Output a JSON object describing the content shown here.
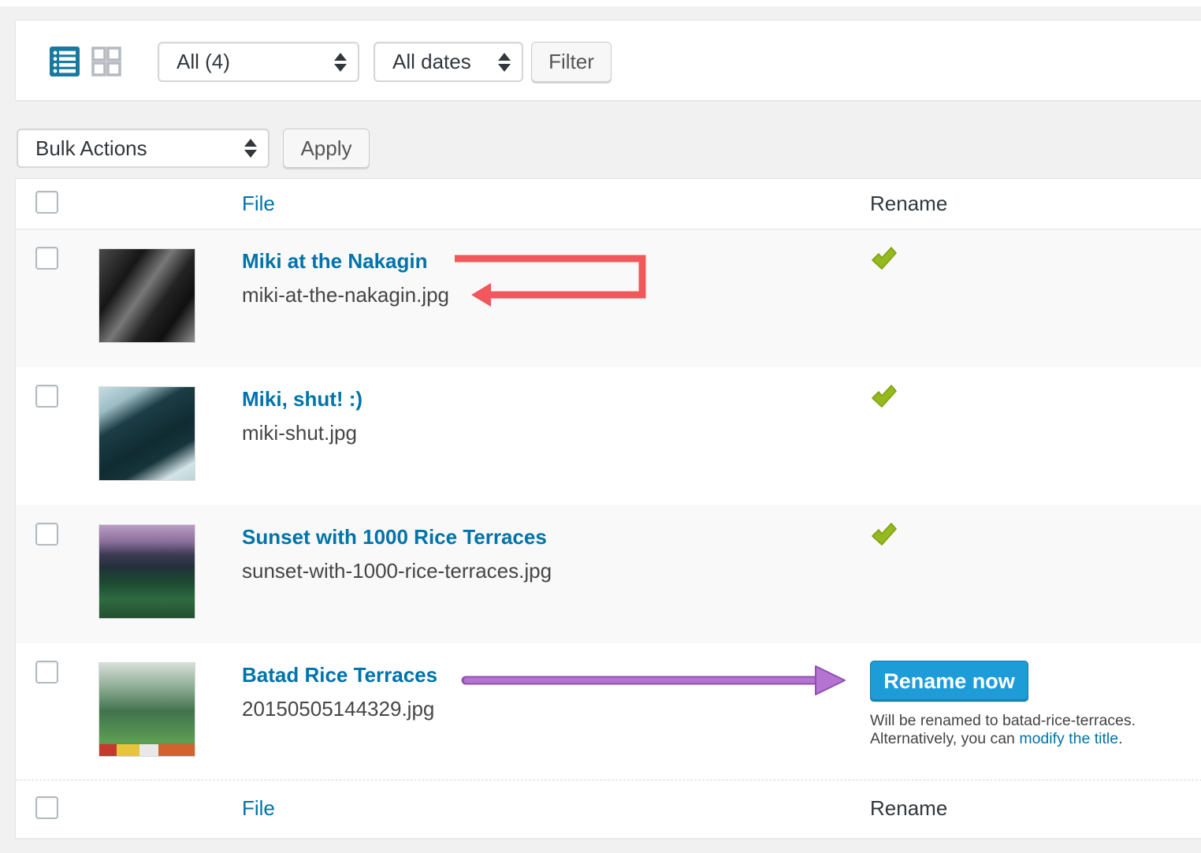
{
  "toolbar": {
    "list_view_icon": "list-view-icon",
    "grid_view_icon": "grid-view-icon",
    "media_filter_value": "All (4)",
    "date_filter_value": "All dates",
    "filter_button_label": "Filter"
  },
  "bulk_actions": {
    "select_value": "Bulk Actions",
    "apply_button_label": "Apply"
  },
  "table": {
    "columns": {
      "file": "File",
      "rename": "Rename"
    },
    "rows": [
      {
        "title": "Miki at the Nakagin",
        "filename": "miki-at-the-nakagin.jpg",
        "rename_status": "green-check"
      },
      {
        "title": "Miki, shut! :)",
        "filename": "miki-shut.jpg",
        "rename_status": "green-check"
      },
      {
        "title": "Sunset with 1000 Rice Terraces",
        "filename": "sunset-with-1000-rice-terraces.jpg",
        "rename_status": "green-check"
      },
      {
        "title": "Batad Rice Terraces",
        "filename": "20150505144329.jpg",
        "rename_status": "pending",
        "rename_button_label": "Rename now",
        "note_line1": "Will be renamed to batad-rice-terraces.",
        "note_line2_prefix": "Alternatively, you can ",
        "note_link_label": "modify the title",
        "note_line2_suffix": "."
      }
    ],
    "footer": {
      "file": "File",
      "rename": "Rename"
    }
  },
  "annotations": {
    "red_arrow": "points to filename miki-at-the-nakagin.jpg",
    "purple_arrow": "points to Rename now button"
  },
  "colors": {
    "link_blue": "#0073aa",
    "primary_button_blue": "#1e9cd8",
    "check_green": "#95ba1d",
    "arrow_red": "#f1575b",
    "arrow_purple": "#b573d2",
    "page_background": "#f1f1f1",
    "alt_row_background": "#f9f9f9"
  }
}
